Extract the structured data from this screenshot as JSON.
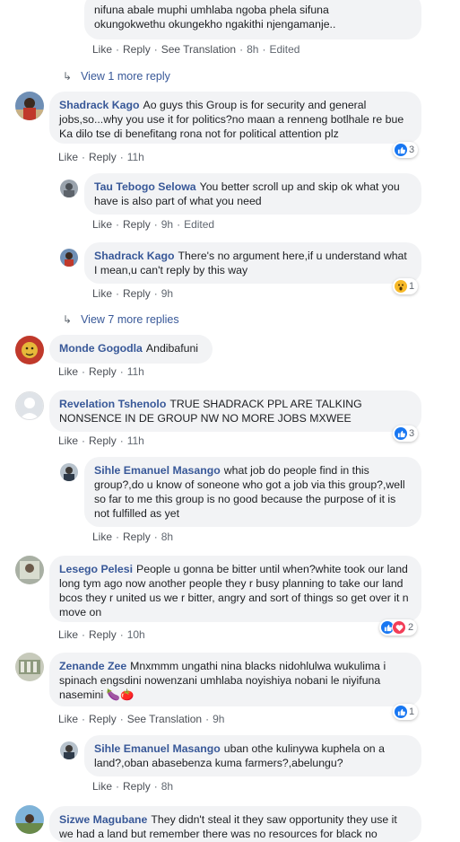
{
  "top_partial": {
    "text_line1": "nifuna abale muphi umhlaba ngoba phela sifuna",
    "text_line2": "okungokwethu okungekho ngakithi njengamanje..",
    "actions": {
      "like": "Like",
      "reply": "Reply",
      "translate": "See Translation",
      "time": "8h",
      "edited": "Edited"
    }
  },
  "more_replies_1": "View 1 more reply",
  "comments": [
    {
      "author": "Shadrack Kago",
      "text": "Ao guys this Group is for security and general jobs,so...why you use it for politics?no maan a renneng botlhale re bue Ka dilo tse di benefitang rona not for political attention plz",
      "like": "Like",
      "reply": "Reply",
      "time": "11h",
      "reaction_count": "3"
    },
    {
      "author": "Tau Tebogo Selowa",
      "text": "You better scroll up and skip ok what you have is also part of what you need",
      "like": "Like",
      "reply": "Reply",
      "time": "9h",
      "edited": "Edited"
    },
    {
      "author": "Shadrack Kago",
      "text": "There's no argument here,if u understand what I mean,u can't reply by this way",
      "like": "Like",
      "reply": "Reply",
      "time": "9h",
      "reaction_count": "1"
    },
    {
      "author": "Monde Gogodla",
      "text": "Andibafuni",
      "like": "Like",
      "reply": "Reply",
      "time": "11h"
    },
    {
      "author": "Revelation Tshenolo",
      "text": "TRUE SHADRACK PPL ARE TALKING NONSENCE IN DE GROUP NW NO MORE JOBS MXWEE",
      "like": "Like",
      "reply": "Reply",
      "time": "11h",
      "reaction_count": "3"
    },
    {
      "author": "Sihle Emanuel Masango",
      "text": "what job do people find in this group?,do u know of soneone who got a job via this group?,well so far to me this group is no good because the purpose of it is not fulfilled as yet",
      "like": "Like",
      "reply": "Reply",
      "time": "8h"
    },
    {
      "author": "Lesego Pelesi",
      "text": "People u gonna be bitter until when?white took our land long tym ago now another people they r busy planning to take our land bcos they r united us we r bitter, angry and sort of things so get over it n move on",
      "like": "Like",
      "reply": "Reply",
      "time": "10h",
      "reaction_count": "2"
    },
    {
      "author": "Zenande Zee",
      "text": "Mnxmmm ungathi nina blacks nidohlulwa wukulima i spinach engsdini nowenzani umhlaba noyishiya nobani le niyifuna nasemini 🍆🍅",
      "like": "Like",
      "reply": "Reply",
      "translate": "See Translation",
      "time": "9h",
      "reaction_count": "1"
    },
    {
      "author": "Sihle Emanuel Masango",
      "text": "uban othe kulinywa kuphela on a land?,oban abasebenza kuma farmers?,abelungu?",
      "like": "Like",
      "reply": "Reply",
      "time": "8h"
    },
    {
      "author": "Sizwe Magubane",
      "text": "They didn't steal it they saw opportunity they use it we had a land but remember there was no resources for black no"
    }
  ],
  "more_replies_2": "View 7 more replies",
  "colors": {
    "author": "#385898",
    "bubble": "#f2f3f5",
    "like_blue": "#1877f2",
    "heart": "#f33e58",
    "wow": "#f7b928"
  }
}
